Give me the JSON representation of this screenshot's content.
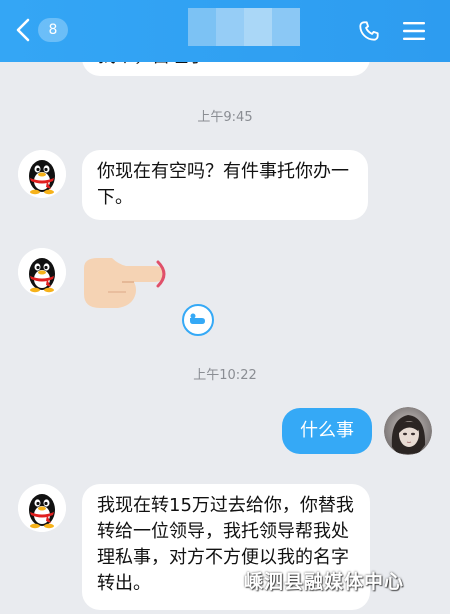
{
  "header": {
    "back_icon": "chevron-left-icon",
    "unread_count": "8",
    "phone_icon": "phone-icon",
    "menu_icon": "menu-icon",
    "color": "#2d9cf0"
  },
  "messages": {
    "partial_top": "找个，自理了",
    "time_1": "上午9:45",
    "msg_1": "你现在有空吗？有件事托你办一下。",
    "sticker_icon": "pointing-finger-sticker",
    "recall_icon": "finger-tap-icon",
    "time_2": "上午10:22",
    "sent_1": "什么事",
    "msg_2": "我现在转15万过去给你，你替我转给一位领导，我托领导帮我处理私事，对方不方便以我的名字转出。"
  },
  "watermark": "嵊泗县融媒体中心",
  "colors": {
    "sent_bubble": "#35a9f6",
    "received_bubble": "#ffffff",
    "background": "#e9ebef"
  }
}
